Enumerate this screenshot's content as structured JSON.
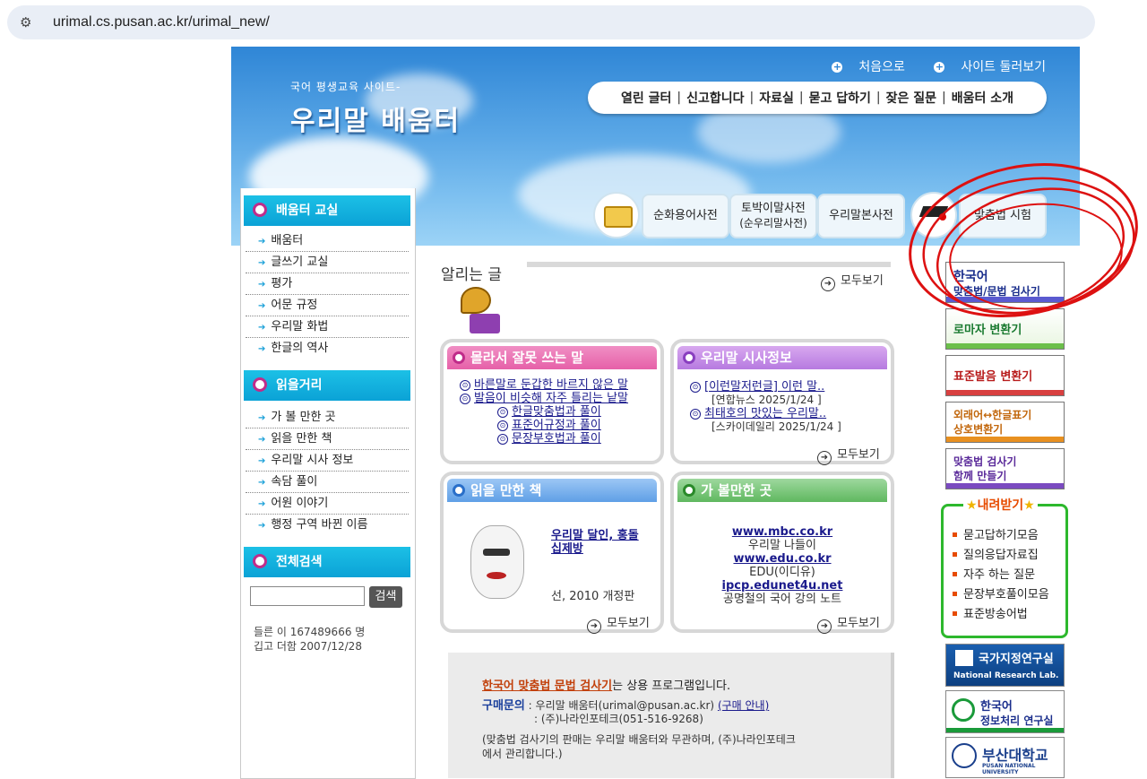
{
  "browser": {
    "url": "urimal.cs.pusan.ac.kr/urimal_new/"
  },
  "header": {
    "subtitle": "국어 평생교육 사이트-",
    "title": "우리말 배움터",
    "top_links": [
      "처음으로",
      "사이트 둘러보기"
    ],
    "nav": [
      "열린 글터",
      "신고합니다",
      "자료실",
      "묻고 답하기",
      "잦은 질문",
      "배움터 소개"
    ],
    "tabs": [
      {
        "line1": "순화용어사전",
        "line2": ""
      },
      {
        "line1": "토박이말사전",
        "line2": "(순우리말사전)"
      },
      {
        "line1": "우리말본사전",
        "line2": ""
      },
      {
        "line1": "맞춤법 시험",
        "line2": ""
      }
    ]
  },
  "sidebar": {
    "section1": {
      "title": "배움터 교실",
      "items": [
        "배움터",
        "글쓰기 교실",
        "평가",
        "어문 규정",
        "우리말 화법",
        "한글의 역사"
      ]
    },
    "section2": {
      "title": "읽을거리",
      "items": [
        "가 볼 만한 곳",
        "읽을 만한 책",
        "우리말 시사 정보",
        "속담 풀이",
        "어원 이야기",
        "행정 구역 바뀐 이름"
      ]
    },
    "section3": {
      "title": "전체검색",
      "search_button": "검색"
    },
    "stats": {
      "line1": "들른 이 167489666 명",
      "line2": "깁고 더함 2007/12/28"
    }
  },
  "main": {
    "notice_title": "알리는 글",
    "more_label": "모두보기",
    "panel_wrong": {
      "title": "몰라서 잘못 쓰는 말",
      "links": [
        "바른말로 둔갑한 바르지 않은 말",
        "발음이 비슷해 자주 틀리는 낱말",
        "한글맞춤법과 풀이",
        "표준어규정과 풀이",
        "문장부호법과 풀이"
      ]
    },
    "panel_news": {
      "title": "우리말 시사정보",
      "items": [
        {
          "link": "[이런말저런글] 이런 말..",
          "source": "[연합뉴스  2025/1/24 ]"
        },
        {
          "link": "최태호의 맛있는 우리말..",
          "source": "[스카이데일리  2025/1/24 ]"
        }
      ]
    },
    "panel_books": {
      "title": "읽을 만한 책",
      "book_title": "우리말 달인, 홍돌 십제방",
      "book_info": "선, 2010 개정판"
    },
    "panel_places": {
      "title": "가 볼만한 곳",
      "sites": [
        {
          "url": "www.mbc.co.kr",
          "name": "우리말 나들이"
        },
        {
          "url": "www.edu.co.kr",
          "name": "EDU(이디유)"
        },
        {
          "url": "ipcp.edunet4u.net",
          "name": "공명철의 국어 강의 노트"
        }
      ]
    },
    "bottom": {
      "product_link": "한국어 맞춤법 문법 검사기",
      "product_text": "는 상용 프로그램입니다.",
      "contact_label": "구매문의",
      "contact1": ": 우리말 배움터(urimal@pusan.ac.kr)",
      "contact_link": "(구매 안내)",
      "contact2": ": (주)나라인포테크(051-516-9268)",
      "disclaimer1": "(맞춤법 검사기의 판매는 우리말 배움터와 무관하며, (주)나라인포테크",
      "disclaimer2": "에서 관리합니다.)"
    }
  },
  "right": {
    "buttons": [
      {
        "line1": "한국어",
        "line2": "맞춤법/문법 검사기"
      },
      {
        "line1": "로마자 변환기",
        "line2": ""
      },
      {
        "line1": "표준발음 변환기",
        "line2": ""
      },
      {
        "line1": "외래어↔한글표기",
        "line2": "상호변환기"
      },
      {
        "line1": "맞춤법 검사기",
        "line2": "함께 만들기"
      }
    ],
    "download_title": "내려받기",
    "downloads": [
      "묻고답하기모음",
      "질의응답자료집",
      "자주 하는 질문",
      "문장부호풀이모음",
      "표준방송어법"
    ],
    "logos": [
      {
        "line1": "국가지정연구실",
        "line2": "National Research Lab."
      },
      {
        "line1": "한국어",
        "line2": "정보처리 연구실"
      },
      {
        "line1": "부산대학교",
        "line2": "PUSAN NATIONAL UNIVERSITY"
      }
    ]
  }
}
